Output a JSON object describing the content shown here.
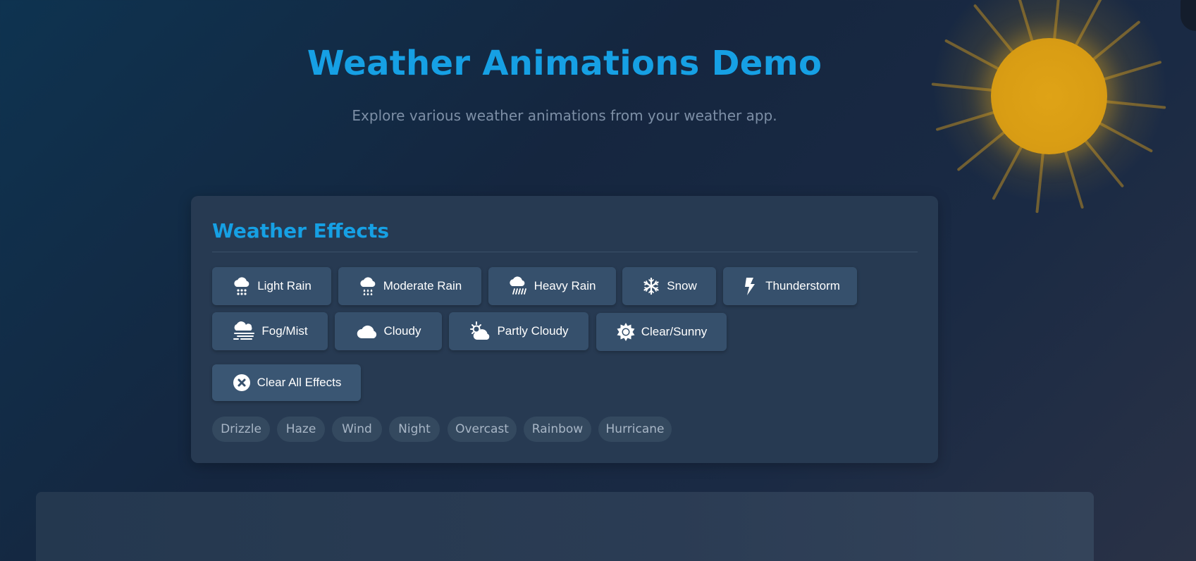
{
  "header": {
    "title": "Weather Animations Demo",
    "subtitle": "Explore various weather animations from your weather app."
  },
  "panel": {
    "title": "Weather Effects",
    "effects": [
      {
        "label": "Light Rain",
        "icon": "light-rain-icon"
      },
      {
        "label": "Moderate Rain",
        "icon": "moderate-rain-icon"
      },
      {
        "label": "Heavy Rain",
        "icon": "heavy-rain-icon"
      },
      {
        "label": "Snow",
        "icon": "snowflake-icon"
      },
      {
        "label": "Thunderstorm",
        "icon": "lightning-icon"
      },
      {
        "label": "Fog/Mist",
        "icon": "fog-icon"
      },
      {
        "label": "Cloudy",
        "icon": "cloud-icon"
      },
      {
        "label": "Partly Cloudy",
        "icon": "partly-cloudy-icon"
      },
      {
        "label": "Clear/Sunny",
        "icon": "sun-icon"
      }
    ],
    "clear_label": "Clear All Effects",
    "tags": [
      "Drizzle",
      "Haze",
      "Wind",
      "Night",
      "Overcast",
      "Rainbow",
      "Hurricane"
    ]
  },
  "colors": {
    "accent": "#16a0e4",
    "button_bg": "#36506c",
    "panel_bg": "#273a52",
    "sun": "#dfa316"
  }
}
